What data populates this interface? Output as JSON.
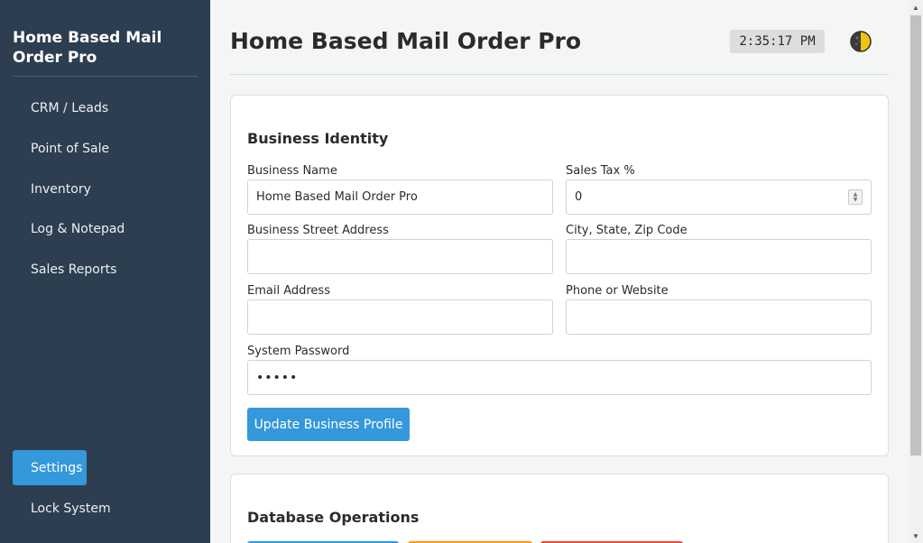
{
  "sidebar": {
    "brand": "Home Based Mail Order Pro",
    "items": [
      {
        "label": "CRM / Leads"
      },
      {
        "label": "Point of Sale"
      },
      {
        "label": "Inventory"
      },
      {
        "label": "Log & Notepad"
      },
      {
        "label": "Sales Reports"
      }
    ],
    "bottom_items": [
      {
        "label": "Settings",
        "active": true
      },
      {
        "label": "Lock System"
      }
    ]
  },
  "header": {
    "title": "Home Based Mail Order Pro",
    "clock": "2:35:17 PM",
    "theme_icon": "half-moon-icon"
  },
  "business_identity": {
    "title": "Business Identity",
    "business_name": {
      "label": "Business Name",
      "value": "Home Based Mail Order Pro"
    },
    "sales_tax": {
      "label": "Sales Tax %",
      "value": "0"
    },
    "street": {
      "label": "Business Street Address",
      "value": ""
    },
    "city": {
      "label": "City, State, Zip Code",
      "value": ""
    },
    "email": {
      "label": "Email Address",
      "value": ""
    },
    "phone": {
      "label": "Phone or Website",
      "value": ""
    },
    "password": {
      "label": "System Password",
      "value": "•••••"
    },
    "update_button": "Update Business Profile"
  },
  "database_ops": {
    "title": "Database Operations"
  },
  "colors": {
    "sidebar_bg": "#2c3e50",
    "accent": "#3498db",
    "orange": "#f39c12",
    "red": "#e74c3c"
  }
}
